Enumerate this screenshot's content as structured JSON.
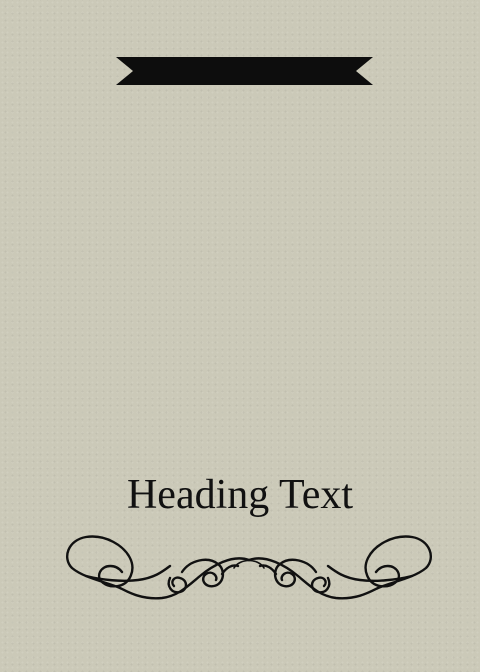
{
  "heading": {
    "text": "Heading Text"
  },
  "colors": {
    "background": "#cbc9b8",
    "ink": "#111111"
  },
  "decorations": {
    "top": "ribbon-banner-icon",
    "bottom": "scroll-flourish-icon"
  }
}
